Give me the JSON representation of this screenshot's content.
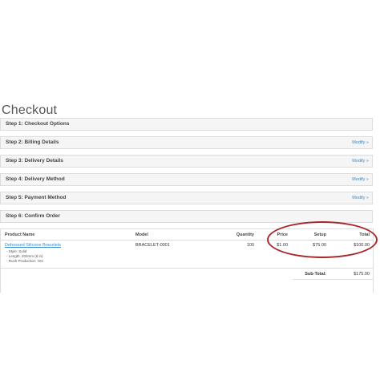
{
  "page": {
    "title": "Checkout"
  },
  "steps": [
    {
      "label": "Step 1: Checkout Options",
      "modify": ""
    },
    {
      "label": "Step 2: Billing Details",
      "modify": "Modify »"
    },
    {
      "label": "Step 3: Delivery Details",
      "modify": "Modify »"
    },
    {
      "label": "Step 4: Delivery Method",
      "modify": "Modify »"
    },
    {
      "label": "Step 5: Payment Method",
      "modify": "Modify »"
    },
    {
      "label": "Step 6: Confirm Order",
      "modify": ""
    }
  ],
  "table": {
    "headers": {
      "product": "Product Name",
      "model": "Model",
      "quantity": "Quantity",
      "price": "Price",
      "setup": "Setup",
      "total": "Total"
    },
    "rows": [
      {
        "product": "Debossed Silicone Bracelets",
        "options": [
          "- Style: Solid",
          "- Length: 202mm (8 in)",
          "- Rush Production: Yes"
        ],
        "model": "BRACELET-0001",
        "quantity": "100",
        "price": "$1.00",
        "setup": "$75.00",
        "total": "$100.00"
      }
    ],
    "subtotal": {
      "label": "Sub-Total:",
      "value": "$175.00"
    }
  },
  "colors": {
    "link": "#3a8bc9",
    "annotation": "#a8262a",
    "panel_bg": "#f5f5f5",
    "border": "#dddddd"
  }
}
